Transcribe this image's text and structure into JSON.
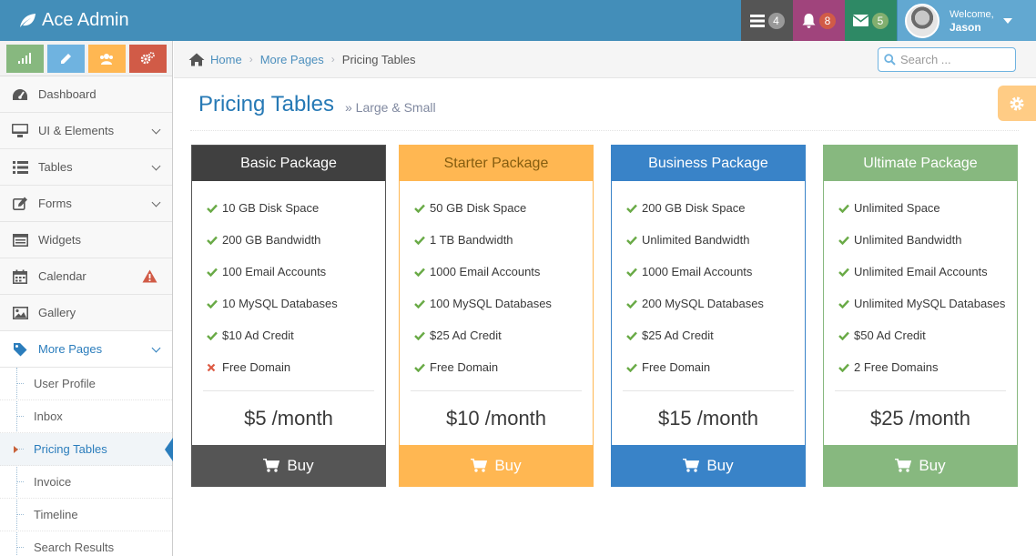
{
  "app": {
    "title": "Ace Admin"
  },
  "navbar": {
    "tasks_count": "4",
    "notifications_count": "8",
    "messages_count": "5",
    "user": {
      "welcome": "Welcome,",
      "name": "Jason"
    }
  },
  "sidebar": {
    "items": [
      {
        "label": "Dashboard",
        "icon": "tachometer-icon"
      },
      {
        "label": "UI & Elements",
        "icon": "desktop-icon"
      },
      {
        "label": "Tables",
        "icon": "list-icon"
      },
      {
        "label": "Forms",
        "icon": "pencil-square-icon"
      },
      {
        "label": "Widgets",
        "icon": "widgets-icon"
      },
      {
        "label": "Calendar",
        "icon": "calendar-icon"
      },
      {
        "label": "Gallery",
        "icon": "picture-icon"
      },
      {
        "label": "More Pages",
        "icon": "tag-icon"
      }
    ],
    "submenu": [
      "User Profile",
      "Inbox",
      "Pricing Tables",
      "Invoice",
      "Timeline",
      "Search Results"
    ]
  },
  "breadcrumb": {
    "home": "Home",
    "parent": "More Pages",
    "current": "Pricing Tables"
  },
  "search": {
    "placeholder": "Search ..."
  },
  "page": {
    "title": "Pricing Tables",
    "subtitle": "Large & Small"
  },
  "colors": {
    "dark": "#555555",
    "starter": "#ffb752",
    "business": "#3983c8",
    "ultimate": "#87b87f",
    "check": "#69aa46",
    "cross": "#dd5a43"
  },
  "plans": [
    {
      "name": "Basic Package",
      "features": [
        {
          "text": "10 GB Disk Space",
          "included": true
        },
        {
          "text": "200 GB Bandwidth",
          "included": true
        },
        {
          "text": "100 Email Accounts",
          "included": true
        },
        {
          "text": "10 MySQL Databases",
          "included": true
        },
        {
          "text": "$10 Ad Credit",
          "included": true
        },
        {
          "text": "Free Domain",
          "included": false
        }
      ],
      "price": "$5 /month",
      "buy": "Buy"
    },
    {
      "name": "Starter Package",
      "features": [
        {
          "text": "50 GB Disk Space",
          "included": true
        },
        {
          "text": "1 TB Bandwidth",
          "included": true
        },
        {
          "text": "1000 Email Accounts",
          "included": true
        },
        {
          "text": "100 MySQL Databases",
          "included": true
        },
        {
          "text": "$25 Ad Credit",
          "included": true
        },
        {
          "text": "Free Domain",
          "included": true
        }
      ],
      "price": "$10 /month",
      "buy": "Buy"
    },
    {
      "name": "Business Package",
      "features": [
        {
          "text": "200 GB Disk Space",
          "included": true
        },
        {
          "text": "Unlimited Bandwidth",
          "included": true
        },
        {
          "text": "1000 Email Accounts",
          "included": true
        },
        {
          "text": "200 MySQL Databases",
          "included": true
        },
        {
          "text": "$25 Ad Credit",
          "included": true
        },
        {
          "text": "Free Domain",
          "included": true
        }
      ],
      "price": "$15 /month",
      "buy": "Buy"
    },
    {
      "name": "Ultimate Package",
      "features": [
        {
          "text": "Unlimited Space",
          "included": true
        },
        {
          "text": "Unlimited Bandwidth",
          "included": true
        },
        {
          "text": "Unlimited Email Accounts",
          "included": true
        },
        {
          "text": "Unlimited MySQL Databases",
          "included": true
        },
        {
          "text": "$50 Ad Credit",
          "included": true
        },
        {
          "text": "2 Free Domains",
          "included": true
        }
      ],
      "price": "$25 /month",
      "buy": "Buy"
    }
  ]
}
